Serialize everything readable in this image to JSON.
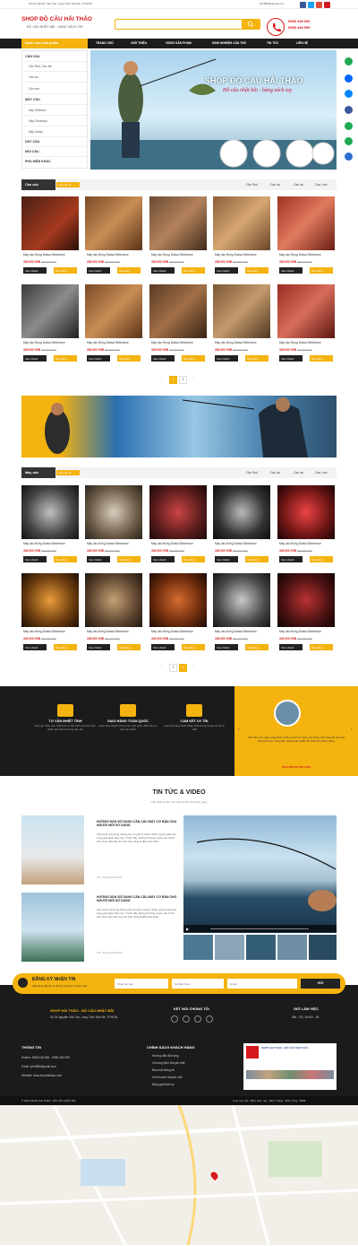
{
  "topbar": {
    "address": "Số 04 Nguyễn Văn Tạo, Long Thới, Nhà Bè, TP.HCM",
    "email": "lph4985@gmail.com"
  },
  "header": {
    "logo": "SHOP ĐỒ CÂU HẢI THẢO",
    "slogan": "ĐỒ CÂU NHẬT BÃI - HÀNG XÁCH TAY",
    "search_placeholder": "",
    "hotline1": "0968 448 666",
    "hotline2": "0968 448 999"
  },
  "nav": {
    "category_label": "Danh mục sản phẩm",
    "items": [
      "TRANG CHỦ",
      "GIỚI THIỆU",
      "VIDEO SẢN PHẨM",
      "KINH NGHIỆM CẦN THỦ",
      "TIN TỨC",
      "LIÊN HỆ"
    ]
  },
  "sidebar": {
    "groups": [
      {
        "title": "CẦN CÂU",
        "items": [
          "Cần Rod, Cần dài",
          "Cần lục",
          "Cần lure"
        ]
      },
      {
        "title": "MÁY CÂU",
        "items": [
          "Máy Shimano",
          "Máy Tsurinoya",
          "Máy Daiwa"
        ]
      },
      {
        "title": "DÂY CÂU",
        "items": []
      },
      {
        "title": "MỒI CÂU",
        "items": []
      },
      {
        "title": "PHỤ KIỆN KHÁC",
        "items": []
      }
    ]
  },
  "banner": {
    "title": "SHOP ĐỒ CÂU HẢI THẢO",
    "subtitle": "Đồ câu nhật bãi - hàng xách tay"
  },
  "section_rods": {
    "title": "Cần câu",
    "tag": "Xem tất cả",
    "links": [
      "Cần Rod",
      "Cần lục",
      "Cần lục",
      "Cần Lure"
    ],
    "product_name": "Máy câu Đứng Daiwa Strikeforce",
    "price": "345.000 VNĐ",
    "old_price": "500.000 VNĐ",
    "view_label": "Xem nhanh",
    "buy_label": "Mua hàng",
    "pages": [
      "1",
      "2"
    ]
  },
  "section_reels": {
    "title": "Máy câu",
    "tag": "Xem tất cả",
    "links": [
      "Cần Rod",
      "Cần lục",
      "Cần lục",
      "Cần Lure"
    ],
    "product_name": "Máy câu Đứng Daiwa Strikeforce",
    "price": "345.000 VNĐ",
    "old_price": "500.000 VNĐ",
    "view_label": "Xem nhanh",
    "buy_label": "Mua hàng",
    "pages": [
      "1",
      "2"
    ]
  },
  "why": {
    "items": [
      {
        "title": "TƯ VẤN NHIỆT TÌNH",
        "desc": "Đội ngũ nhân viên nhiệt tình tư vấn cách lựa chọn sản phẩm phù hợp với từng nhu cầu"
      },
      {
        "title": "GIAO HÀNG TOÀN QUỐC",
        "desc": "Giao hàng nhanh chóng trên toàn quốc, đảm bảo an toàn sản phẩm"
      },
      {
        "title": "CAM KẾT UY TÍN",
        "desc": "Cam kết hàng chính hãng, chất lượng và giá cả hợp lý nhất"
      }
    ],
    "testimonial": "Cần câu máy ngày càng được nhiều người sử dụng. Hệ thống cửa hàng đồ câu của chúng tôi luôn mang đến những sản phẩm tốt nhất cho khách hàng.",
    "author": "NGUYỄN HUỲNH ANH"
  },
  "news": {
    "title": "TIN TỨC & VIDEO",
    "subtitle": "Cập nhật tin tức mới nhất về đồ câu hằng ngày",
    "articles": [
      {
        "title": "HƯỚNG DẪN SỬ DỤNG CẦN CÂU MÁY CƠ BẢN CHO NGƯỜI MỚI SỬ DỤNG",
        "desc": "Câu cá là một trong những thú vui giải trí được nhiều người quan tâm trong giai đoạn hiện nay. Trước đây, không thường xuyên câu cá thì việc chọn cần câu cho phù hợp cũng là điều khó khăn.",
        "date": "Thứ, tháng 01/01/2021"
      },
      {
        "title": "HƯỚNG DẪN SỬ DỤNG CẦN CÂU MÁY CƠ BẢN CHO NGƯỜI MỚI SỬ DỤNG",
        "desc": "Câu cá là một trong những thú vui giải trí được nhiều người quan tâm trong giai đoạn hiện nay. Trước đây, không thường xuyên câu cá thì việc chọn cần câu cho phù hợp cũng là điều khó khăn.",
        "date": "Thứ, tháng 01/01/2021"
      }
    ]
  },
  "newsletter": {
    "title": "ĐĂNG KÝ NHẬN TIN",
    "subtitle": "Hãy để lại đây để có những thông tin khuyến mãi",
    "name_placeholder": "Nhập tên bạn",
    "phone_placeholder": "Số điện thoại",
    "email_placeholder": "Email",
    "button": "GỬI"
  },
  "footer": {
    "shop_name": "SHOP HẢI THẢO - ĐỒ CÂU NHẬT BÃI",
    "address": "Số 04 Nguyễn Văn Tạo, Long Thới, Nhà Bè, TP.HCM",
    "connect": "KẾT NỐI CHÚNG TÔI",
    "hours_title": "GIỜ LÀM VIỆC",
    "hours": "08h : 00 | 16 h00 - 06",
    "info_title": "THÔNG TIN",
    "phone": "Hotline: 0968 448 666 - 0968 448 999",
    "email": "Email: lph4985@gmail.com",
    "website": "Website: www.shophaithao.com",
    "policy_title": "CHÍNH SÁCH KHÁCH HÀNG",
    "policies": [
      "Hướng dẫn đặt hàng",
      "Chương trình khuyến mãi",
      "Bảo mật thông tin",
      "Chính sách khuyến mãi",
      "Đăng giải định ký"
    ],
    "fanpage": "SHOP HẢI THẢO - ĐỒ CÂU NHẬT BÃI",
    "copyright": "© 2021 SHOP HẢI THẢO - ĐỒ CÂU NHẬT BÃI",
    "stats": "Lượt truy cập : 999 | Hôm nay : 500 | Tháng : 999 | Tổng : 9999"
  },
  "colors": {
    "accent": "#f4b30f",
    "brand_red": "#d6181e",
    "dark": "#1b1b1b"
  }
}
